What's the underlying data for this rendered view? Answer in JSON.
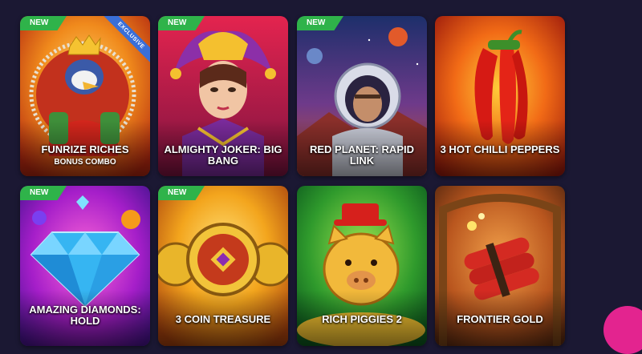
{
  "badges": {
    "new": "NEW",
    "exclusive": "EXCLUSIVE"
  },
  "games": [
    {
      "title": "FUNRIZE RICHES",
      "subtitle": "BONUS COMBO",
      "tag": "NEW",
      "ribbon": "EXCLUSIVE"
    },
    {
      "title": "ALMIGHTY JOKER: BIG BANG",
      "tag": "NEW"
    },
    {
      "title": "RED PLANET: RAPID LINK",
      "tag": "NEW"
    },
    {
      "title": "3 HOT CHILLI PEPPERS"
    },
    {
      "title": "AMAZING DIAMONDS: HOLD",
      "tag": "NEW"
    },
    {
      "title": "3 COIN TREASURE",
      "tag": "NEW"
    },
    {
      "title": "RICH PIGGIES 2"
    },
    {
      "title": "FRONTIER GOLD"
    }
  ],
  "colors": {
    "background": "#1b1833",
    "new_badge": "#2fb34a",
    "exclusive_ribbon": "#3a6fd8",
    "chat_button": "#e3248f"
  }
}
